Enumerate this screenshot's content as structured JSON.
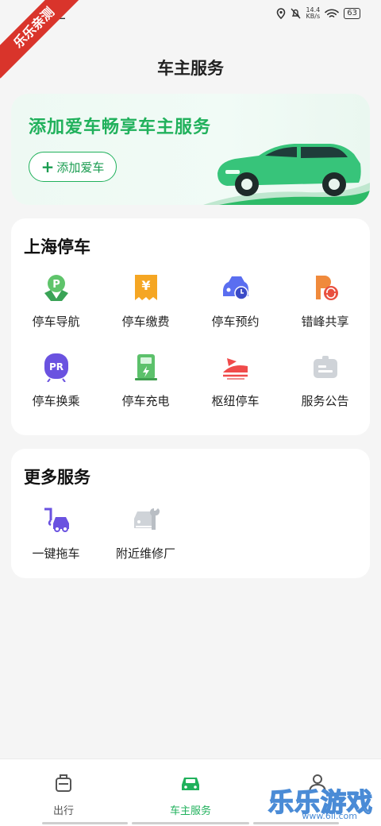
{
  "status_bar": {
    "time": "32",
    "speed_value": "14.4",
    "speed_unit": "KB/s",
    "battery": "63"
  },
  "watermark_ribbon": "乐乐亲测",
  "header": {
    "title": "车主服务"
  },
  "banner": {
    "title": "添加爱车畅享车主服务",
    "button_label": "添加爱车"
  },
  "parking": {
    "title": "上海停车",
    "items": [
      {
        "label": "停车导航",
        "icon": "parking-location-icon"
      },
      {
        "label": "停车缴费",
        "icon": "yuan-receipt-icon"
      },
      {
        "label": "停车预约",
        "icon": "car-clock-icon"
      },
      {
        "label": "错峰共享",
        "icon": "parking-share-icon"
      },
      {
        "label": "停车换乘",
        "icon": "park-and-ride-icon"
      },
      {
        "label": "停车充电",
        "icon": "charging-station-icon"
      },
      {
        "label": "枢纽停车",
        "icon": "train-hub-icon"
      },
      {
        "label": "服务公告",
        "icon": "notice-icon"
      }
    ]
  },
  "more": {
    "title": "更多服务",
    "items": [
      {
        "label": "一键拖车",
        "icon": "tow-truck-icon"
      },
      {
        "label": "附近维修厂",
        "icon": "car-repair-icon"
      }
    ]
  },
  "tabbar": {
    "tabs": [
      {
        "label": "出行",
        "icon": "luggage-icon"
      },
      {
        "label": "车主服务",
        "icon": "car-icon"
      },
      {
        "label": "",
        "icon": "person-icon"
      }
    ]
  },
  "watermark": {
    "text": "乐乐游戏",
    "url": "www.6ll.com"
  },
  "colors": {
    "accent": "#21b15c",
    "banner_bg": "#eef9f3",
    "ribbon": "#d9342b"
  }
}
